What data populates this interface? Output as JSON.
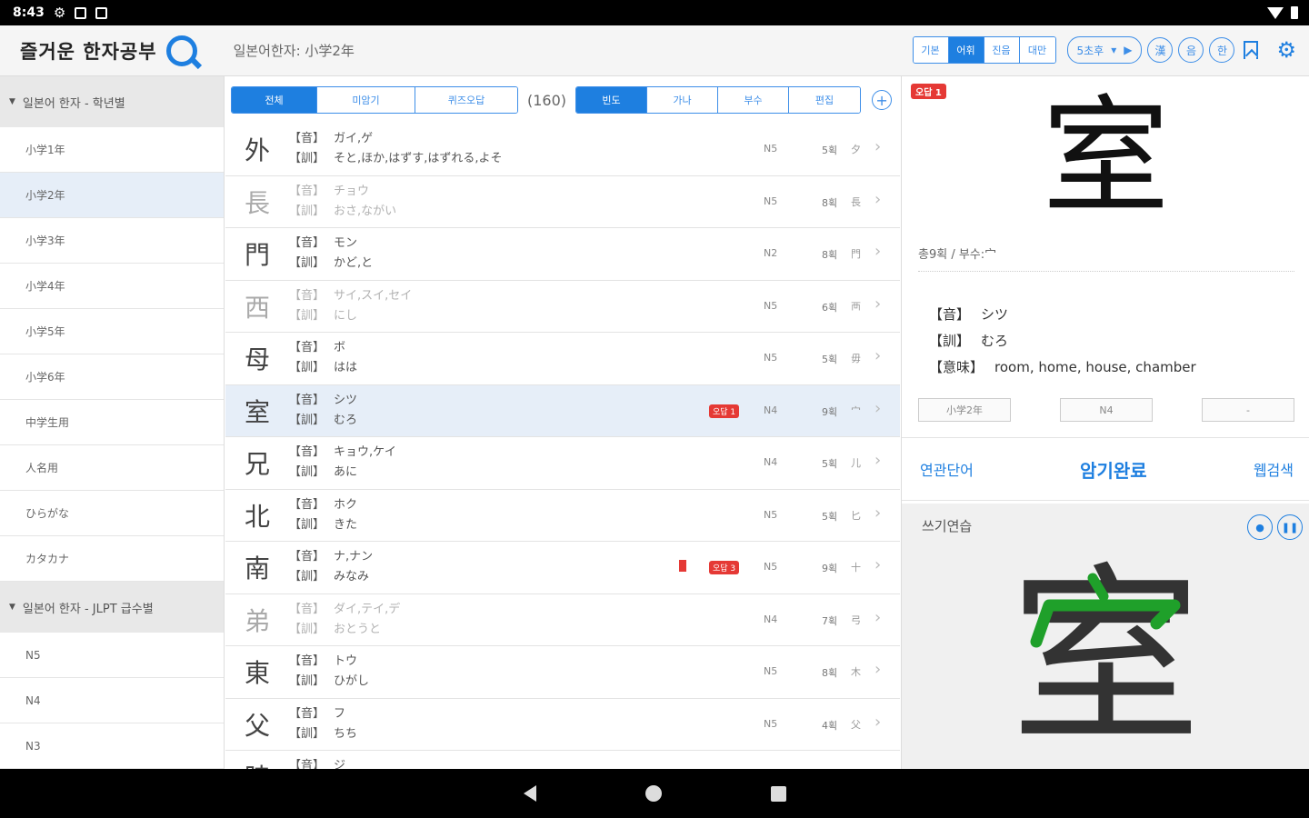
{
  "status": {
    "time": "8:43"
  },
  "header": {
    "title": "즐거운 한자공부",
    "subtitle": "일본어한자: 小学2年",
    "modes": [
      "기본",
      "어휘",
      "진음",
      "대만"
    ],
    "active_mode": 1,
    "speed": "5초후",
    "circle_buttons": [
      "漢",
      "음",
      "한"
    ]
  },
  "sidebar": {
    "section1": "일본어 한자 - 학년별",
    "grades": [
      "小学1年",
      "小学2年",
      "小学3年",
      "小学4年",
      "小学5年",
      "小学6年",
      "中学生用",
      "人名用",
      "ひらがな",
      "カタカナ"
    ],
    "selected_grade": 1,
    "section2": "일본어 한자 - JLPT 급수별",
    "jlpt": [
      "N5",
      "N4",
      "N3"
    ]
  },
  "filters": {
    "left": [
      "전체",
      "미암기",
      "퀴즈오답"
    ],
    "count": "(160)",
    "right": [
      "빈도",
      "가나",
      "부수",
      "편집"
    ]
  },
  "rows": [
    {
      "kanji": "外",
      "on": "ガイ,ゲ",
      "kun": "そと,ほか,はずす,はずれる,よそ",
      "jlpt": "N5",
      "strokes": "5획",
      "radical": "夕"
    },
    {
      "kanji": "長",
      "on": "チョウ",
      "kun": "おさ,ながい",
      "jlpt": "N5",
      "strokes": "8획",
      "radical": "長"
    },
    {
      "kanji": "門",
      "on": "モン",
      "kun": "かど,と",
      "jlpt": "N2",
      "strokes": "8획",
      "radical": "門"
    },
    {
      "kanji": "西",
      "on": "サイ,スイ,セイ",
      "kun": "にし",
      "jlpt": "N5",
      "strokes": "6획",
      "radical": "襾"
    },
    {
      "kanji": "母",
      "on": "ボ",
      "kun": "はは",
      "jlpt": "N5",
      "strokes": "5획",
      "radical": "毋"
    },
    {
      "kanji": "室",
      "on": "シツ",
      "kun": "むろ",
      "jlpt": "N4",
      "strokes": "9획",
      "radical": "宀",
      "badge": "오답 1"
    },
    {
      "kanji": "兄",
      "on": "キョウ,ケイ",
      "kun": "あに",
      "jlpt": "N4",
      "strokes": "5획",
      "radical": "儿"
    },
    {
      "kanji": "北",
      "on": "ホク",
      "kun": "きた",
      "jlpt": "N5",
      "strokes": "5획",
      "radical": "匕"
    },
    {
      "kanji": "南",
      "on": "ナ,ナン",
      "kun": "みなみ",
      "jlpt": "N5",
      "strokes": "9획",
      "radical": "十",
      "badge": "오답 3"
    },
    {
      "kanji": "弟",
      "on": "ダイ,テイ,デ",
      "kun": "おとうと",
      "jlpt": "N4",
      "strokes": "7획",
      "radical": "弓"
    },
    {
      "kanji": "東",
      "on": "トウ",
      "kun": "ひがし",
      "jlpt": "N5",
      "strokes": "8획",
      "radical": "木"
    },
    {
      "kanji": "父",
      "on": "フ",
      "kun": "ちち",
      "jlpt": "N5",
      "strokes": "4획",
      "radical": "父"
    },
    {
      "kanji": "時",
      "on": "ジ",
      "kun": "",
      "jlpt": "",
      "strokes": "",
      "radical": ""
    }
  ],
  "labels": {
    "on": "【音】",
    "kun": "【訓】",
    "meaning": "【意味】"
  },
  "detail": {
    "badge": "오답 1",
    "kanji": "室",
    "meta": "총9획 / 부수:宀",
    "on": "シツ",
    "kun": "むろ",
    "meaning": "room, home, house, chamber",
    "tags": [
      "小学2年",
      "N4",
      "-"
    ],
    "actions": [
      "연관단어",
      "암기완료",
      "웹검색"
    ],
    "practice_title": "쓰기연습"
  },
  "colors": {
    "accent": "#1e7fe0",
    "badge": "#e53935",
    "stroke_green": "#1fa02a"
  }
}
